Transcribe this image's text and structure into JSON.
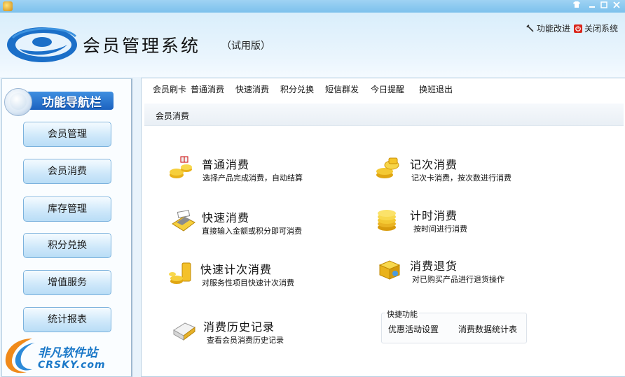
{
  "window": {
    "controls": [
      "shirt-icon",
      "minimize-icon",
      "maximize-icon",
      "close-icon"
    ]
  },
  "header": {
    "title": "会员管理系统",
    "edition": "（试用版）",
    "links": [
      {
        "label": "功能改进",
        "icon": "wrench-icon"
      },
      {
        "label": "关闭系统",
        "icon": "power-icon",
        "color": "#d9261c"
      }
    ]
  },
  "sidebar": {
    "heading": "功能导航栏",
    "items": [
      {
        "label": "会员管理"
      },
      {
        "label": "会员消费"
      },
      {
        "label": "库存管理"
      },
      {
        "label": "积分兑换"
      },
      {
        "label": "增值服务"
      },
      {
        "label": "统计报表"
      }
    ]
  },
  "menu": {
    "items": [
      "会员刷卡",
      "普通消费",
      "快速消费",
      "积分兑换",
      "短信群发",
      "今日提醒",
      "换班退出"
    ]
  },
  "breadcrumb": "会员消费",
  "features": [
    {
      "title": "普通消费",
      "desc": "选择产品完成消费，自动结算",
      "icon": "coins-gift-icon"
    },
    {
      "title": "记次消费",
      "desc": "记次卡消费，按次数进行消费",
      "icon": "coins-stack-icon"
    },
    {
      "title": "快速消费",
      "desc": "直接输入金额或积分即可消费",
      "icon": "cash-register-icon"
    },
    {
      "title": "计时消费",
      "desc": "按时间进行消费",
      "icon": "coin-tower-icon"
    },
    {
      "title": "快速计次消费",
      "desc": "对服务性项目快速计次消费",
      "icon": "gold-coins-icon"
    },
    {
      "title": "消费退货",
      "desc": "对已购买产品进行退货操作",
      "icon": "return-box-icon"
    },
    {
      "title": "消费历史记录",
      "desc": "查看会员消费历史记录",
      "icon": "history-receipt-icon"
    }
  ],
  "quick": {
    "title": "快捷功能",
    "links": [
      "优惠活动设置",
      "消费数据统计表"
    ]
  },
  "watermark": {
    "name": "非凡软件站",
    "domain": "CRSKY.com"
  },
  "colors": {
    "accent": "#1c62c0",
    "header_bg": "#d9eefb",
    "button_bg": "#cde7fa"
  }
}
